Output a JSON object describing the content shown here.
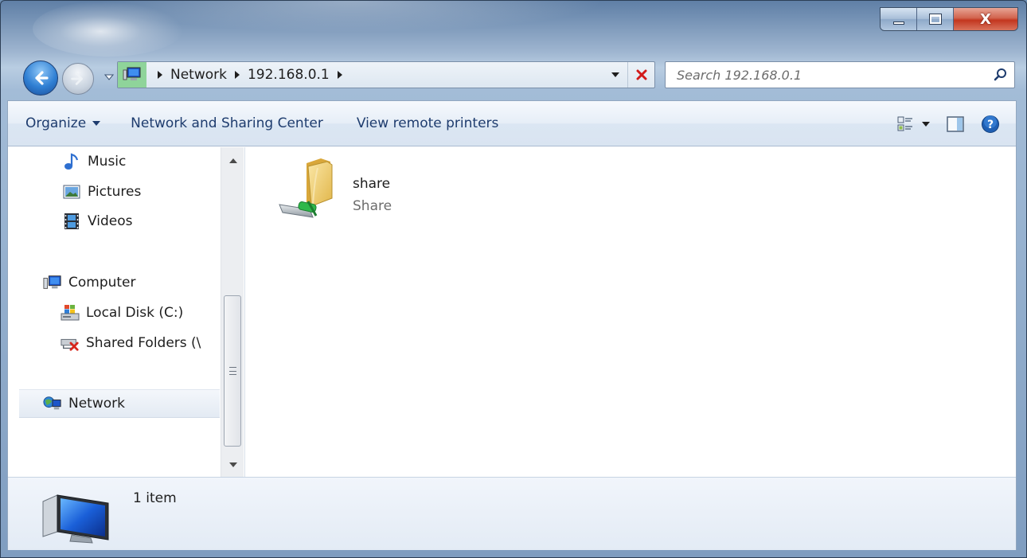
{
  "window": {
    "minimize_icon": "minimize-icon",
    "maximize_icon": "maximize-icon",
    "close_label": "X"
  },
  "address_bar": {
    "breadcrumbs": [
      "Network",
      "192.168.0.1"
    ],
    "location_icon": "computer-icon"
  },
  "search": {
    "placeholder": "Search 192.168.0.1"
  },
  "toolbar": {
    "organize_label": "Organize",
    "network_sharing_label": "Network and Sharing Center",
    "view_remote_printers_label": "View remote printers"
  },
  "nav_pane": {
    "items": [
      {
        "label": "Music",
        "icon": "music-icon"
      },
      {
        "label": "Pictures",
        "icon": "pictures-icon"
      },
      {
        "label": "Videos",
        "icon": "videos-icon"
      },
      {
        "label": "Computer",
        "icon": "computer-icon"
      },
      {
        "label": "Local Disk (C:)",
        "icon": "local-disk-icon"
      },
      {
        "label": "Shared Folders (\\",
        "icon": "shared-folders-icon"
      },
      {
        "label": "Network",
        "icon": "network-icon"
      }
    ],
    "selected": "Network"
  },
  "files": [
    {
      "name": "share",
      "type": "Share",
      "icon": "network-share-folder-icon"
    }
  ],
  "details": {
    "count_text": "1 item",
    "icon": "computer-monitor-icon"
  },
  "colors": {
    "frame": "#7f9dc0",
    "toolbar_text": "#1e3c6e",
    "close_red": "#c3361f",
    "selection": "#e3eaf3"
  }
}
